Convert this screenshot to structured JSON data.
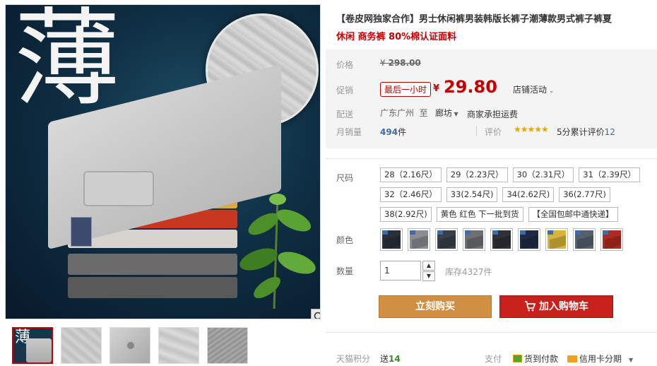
{
  "gallery": {
    "big_char": "薄",
    "thumb_char": "薄"
  },
  "product": {
    "title": "【卷皮网独家合作】男士休闲裤男装韩版长裤子潮薄款男式裤子裤夏",
    "subtitle": "休闲 商务裤 80%棉认证面料"
  },
  "price": {
    "label": "价格",
    "original_prefix": "¥",
    "original": "298.00",
    "promo_label": "促销",
    "promo_badge": "最后一小时",
    "currency": "¥",
    "current": "29.80",
    "shop_activity": "店铺活动",
    "shipping_label": "配送",
    "ship_from": "广东广州",
    "ship_to_word": "至",
    "ship_to": "廊坊",
    "ship_fee": "商家承担运费"
  },
  "sales": {
    "label": "月销量",
    "count": "494",
    "unit": "件",
    "review_label": "评价",
    "stars": "★★★★★",
    "score_text": "5分累计评价",
    "review_count": "12"
  },
  "options": {
    "size_label": "尺码",
    "sizes": [
      "28（2.16尺）",
      "29（2.23尺）",
      "30（2.31尺）",
      "31（2.39尺）",
      "32（2.46尺）",
      "33(2.54尺)",
      "34(2.62尺)",
      "36(2.77尺)",
      "38(2.92尺)",
      "黄色 红色 下一批到货",
      "【全国包邮中通快递】"
    ],
    "color_label": "颜色",
    "colors": [
      "#2b2f3a",
      "#8a8d93",
      "#3a3f4a",
      "#6e6f72",
      "#2f3038",
      "#1f2a44",
      "#d9b43a",
      "#55606e",
      "#b02a22"
    ],
    "qty_label": "数量",
    "qty_value": "1",
    "qty_up": "▲",
    "qty_down": "▼",
    "stock": "库存4327件"
  },
  "actions": {
    "buy": "立刻购买",
    "cart": "加入购物车"
  },
  "footer": {
    "points_label": "天猫积分",
    "points_prefix": "送",
    "points_value": "14",
    "pay_label": "支付",
    "cod": "货到付款",
    "credit": "信用卡分期"
  },
  "colors": {
    "accent_red": "#c40000",
    "buy_orange": "#d18f44",
    "cart_red": "#c8201a",
    "link_blue": "#3d6ca8"
  }
}
